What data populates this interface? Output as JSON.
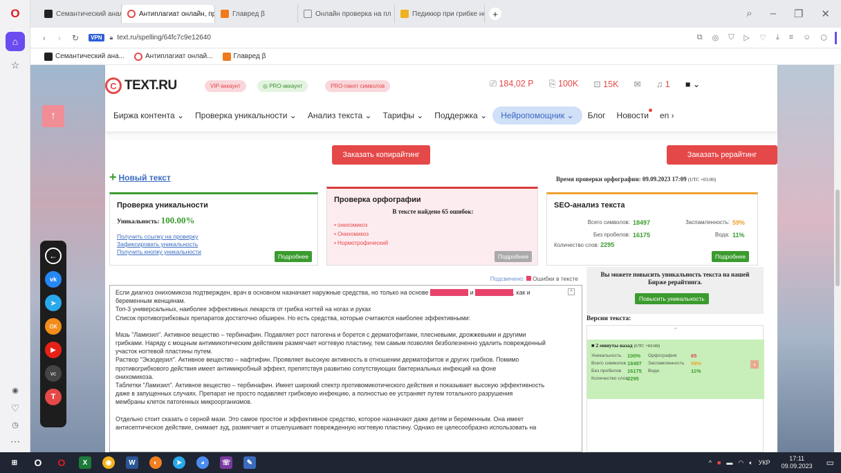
{
  "browser": {
    "tabs": [
      {
        "label": "Семантический анализ"
      },
      {
        "label": "Антиплагиат онлайн, пр"
      },
      {
        "label": "Главред β"
      },
      {
        "label": "Онлайн проверка на пл"
      },
      {
        "label": "Педикюр при грибке но"
      }
    ],
    "new_tab": "+",
    "url": "text.ru/spelling/64fc7c9e12640",
    "vpn_label": "VPN",
    "bookmarks": [
      "Семантический ана...",
      "Антиплагиат онлай...",
      "Главред β"
    ]
  },
  "site": {
    "logo": "TEXT.RU",
    "badges": {
      "vip": "VIP-аккаунт",
      "pro": "PRO-аккаунт",
      "pro_pack": "PRO-пакет символов"
    },
    "balance": "184,02 Р",
    "chars": "100K",
    "texts": "15K",
    "notifications": "1",
    "nav": [
      "Биржа контента",
      "Проверка уникальности",
      "Анализ текста",
      "Тарифы",
      "Поддержка",
      "Нейропомощник",
      "Блог",
      "Новости",
      "en"
    ],
    "order_copy": "Заказать копирайтинг",
    "order_rewrite": "Заказать рерайтинг",
    "new_text": "Новый текст",
    "check_time_label": "Время проверки орфографии: 09.09.2023 17:09",
    "check_time_tz": "(UTC +03:00)"
  },
  "uniq": {
    "title": "Проверка уникальности",
    "label": "Уникальность:",
    "value": "100.00%",
    "links": [
      "Получить ссылку на проверку",
      "Зафиксировать уникальность",
      "Получить кнопку уникальности"
    ],
    "more": "Подробнее"
  },
  "spell": {
    "title": "Проверка орфографии",
    "found": "В тексте найдено 65 ошибок:",
    "errors": [
      "онихомикоз",
      "Онихомикоз",
      "Нормотрофический"
    ],
    "more": "Подробнее"
  },
  "seo": {
    "title": "SEO-анализ текста",
    "total_label": "Всего символов:",
    "total": "18497",
    "nospace_label": "Без пробелов:",
    "nospace": "16175",
    "words_label": "Количество слов:",
    "words": "2295",
    "spam_label": "Заспамленность:",
    "spam": "59%",
    "water_label": "Вода:",
    "water": "11%",
    "more": "Подробнее"
  },
  "editor": {
    "legend_prefix": "Подсвечено:",
    "legend_label": "Ошибки в тексте",
    "lines": [
      "Если диагноз онихомикоза подтвержден, врач в основном назначает наружные средства, но только на основе",
      "беременным женщинам.",
      "Топ-3 универсальных, наиболее эффективных лекарств от грибка ногтей на ногах и руках",
      "Список противогрибковых препаратов достаточно обширен. Но есть средства, которые считаются наиболее эффективными:",
      "Мазь \"Ламизил\". Активное вещество – тербинафин. Подавляет рост патогена и борется с дерматофитами, плесневыми, дрожжевыми и другими",
      "грибками. Наряду с мощным антимикотическим действием размягчает ногтевую пластину, тем самым позволяя безболезненно удалить поврежденный",
      "участок ногтевой пластины путем.",
      "Раствор \"Экзодерил\". Активное вещество – нафтифин. Проявляет высокую активность в отношении дерматофитов и других грибков. Помимо",
      "противогрибкового действия имеет антимикробный эффект, препятствуя развитию сопутствующих бактериальных инфекций на фоне",
      "онихомикоза.",
      "Таблетки \"Ламизил\". Активное вещество – тербинафин. Имеет широкий спектр противомикотического действия и показывает высокую эффективность",
      "даже в запущенных случаях. Препарат не просто подавляет грибковую инфекцию, а полностью ее устраняет путем тотального разрушения",
      "мембраны клеток патогенных микроорганизмов.",
      "Отдельно стоит сказать о серной мази. Это самое простое и эффективное средство, которое назначают даже детям и беременным. Она имеет",
      "антисептическое действие, снимает зуд, размягчает и отшелушивает поврежденную ногтевую пластину. Однако ее целесообразно использовать на"
    ]
  },
  "side": {
    "promo": "Вы можете повысить уникальность текста на нашей Бирже рерайтинга.",
    "promo_btn": "Повысить уникальность",
    "versions_title": "Версии текста:",
    "version_time": "2 минуты назад",
    "version_tz": "(UTC +03:00)",
    "v_uniq_label": "Уникальность",
    "v_uniq": "100%",
    "v_spell_label": "Орфография",
    "v_spell": "65",
    "v_total_label": "Всего символов",
    "v_total": "18497",
    "v_spam_label": "Заспамленность",
    "v_spam": "59%",
    "v_nospace_label": "Без пробелов",
    "v_nospace": "16175",
    "v_water_label": "Вода",
    "v_water": "11%",
    "v_words_label": "Количество слов",
    "v_words": "2295"
  },
  "taskbar": {
    "lang": "УКР",
    "time": "17:11",
    "date": "09.09.2023"
  }
}
